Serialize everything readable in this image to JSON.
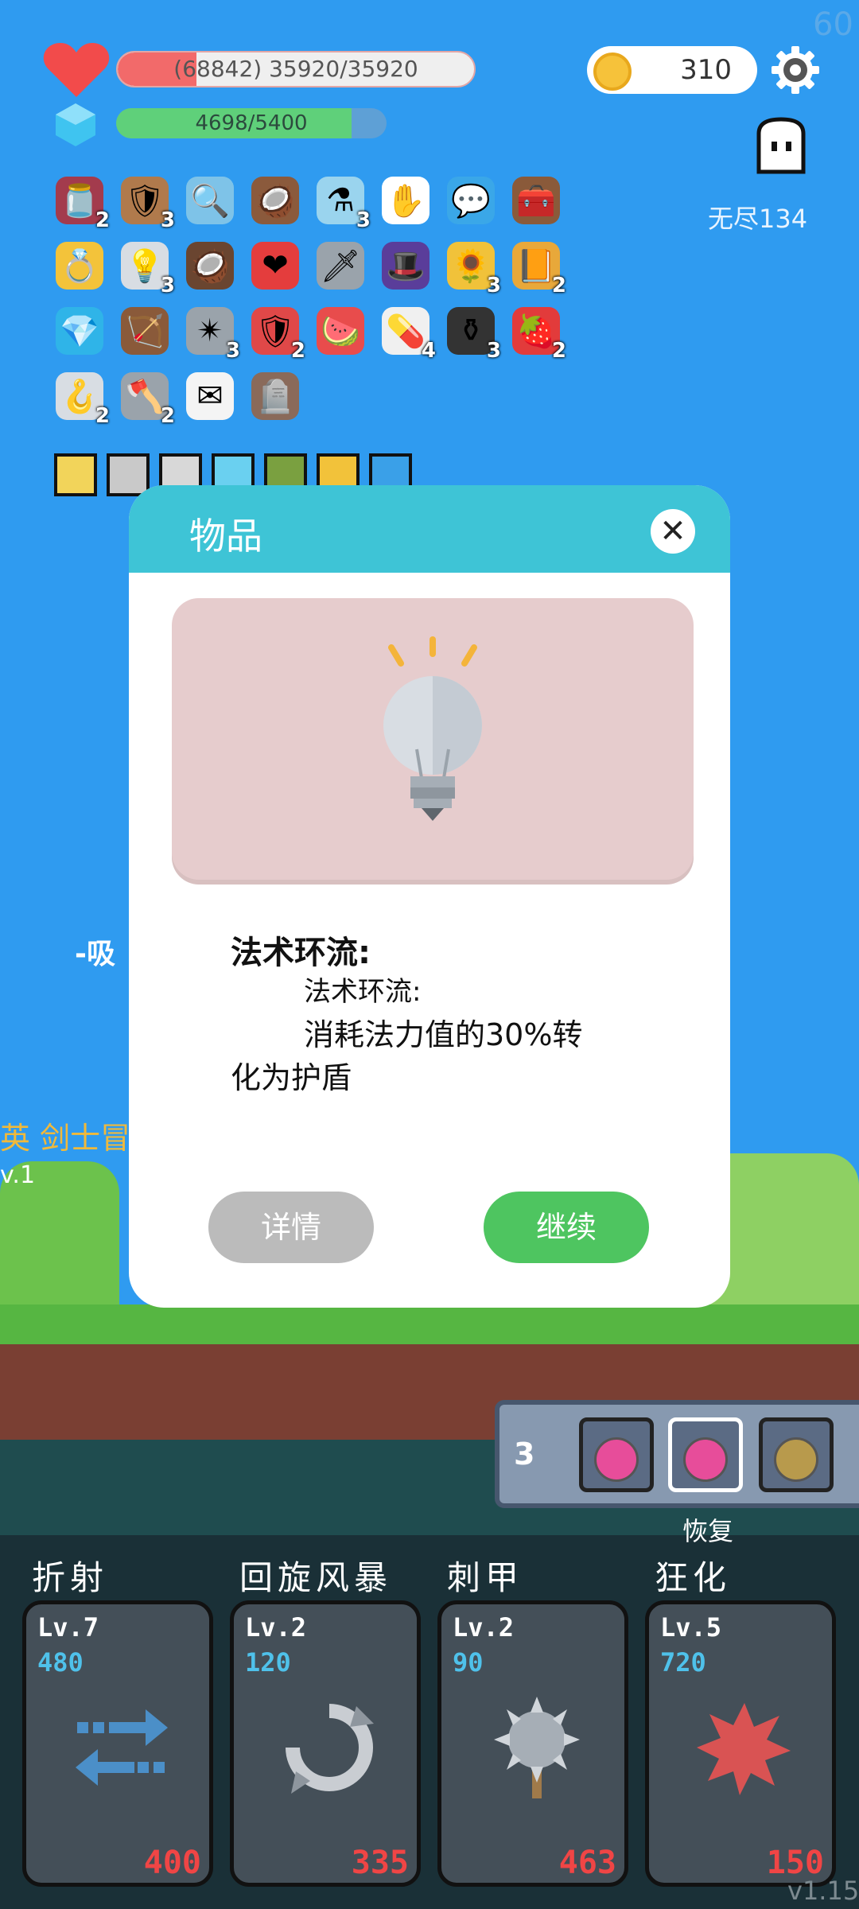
{
  "hud": {
    "fps": "60",
    "hp_text": "(68842) 35920/35920",
    "hp_fraction": 0.22,
    "mp_text": "4698/5400",
    "mp_fraction": 0.87,
    "coins": "310",
    "mode_label": "无尽134"
  },
  "inventory": {
    "items": [
      {
        "icon": "jam-jar-icon",
        "glyph": "🫙",
        "count": "2",
        "bg": "#a33b4d"
      },
      {
        "icon": "wooden-shield-icon",
        "glyph": "🛡",
        "count": "3",
        "bg": "#b07a4c"
      },
      {
        "icon": "magnifier-icon",
        "glyph": "🔍",
        "count": "",
        "bg": "#7ec3e8"
      },
      {
        "icon": "coconut-drink-icon",
        "glyph": "🥥",
        "count": "",
        "bg": "#8b5a3c"
      },
      {
        "icon": "potion-flask-icon",
        "glyph": "⚗",
        "count": "3",
        "bg": "#9ad4ee"
      },
      {
        "icon": "glove-icon",
        "glyph": "✋",
        "count": "",
        "bg": "#ffffff"
      },
      {
        "icon": "speech-bubble-icon",
        "glyph": "💬",
        "count": "",
        "bg": "#3aa7e8"
      },
      {
        "icon": "treasure-chest-icon",
        "glyph": "🧰",
        "count": "",
        "bg": "#8a5a3a"
      },
      {
        "icon": "ring-icon",
        "glyph": "💍",
        "count": "",
        "bg": "#f3c33a"
      },
      {
        "icon": "light-bulb-icon",
        "glyph": "💡",
        "count": "3",
        "bg": "#d8dde3"
      },
      {
        "icon": "coconut-icon",
        "glyph": "🥥",
        "count": "",
        "bg": "#6a4530"
      },
      {
        "icon": "hearts-icon",
        "glyph": "❤",
        "count": "",
        "bg": "#e43d3d"
      },
      {
        "icon": "sword-icon",
        "glyph": "🗡",
        "count": "",
        "bg": "#9aa3ab"
      },
      {
        "icon": "purple-hat-icon",
        "glyph": "🎩",
        "count": "",
        "bg": "#5a3d9a"
      },
      {
        "icon": "sunflower-icon",
        "glyph": "🌻",
        "count": "3",
        "bg": "#f1c23a"
      },
      {
        "icon": "book-icon",
        "glyph": "📙",
        "count": "2",
        "bg": "#e8a83a"
      },
      {
        "icon": "blue-gem-icon",
        "glyph": "💎",
        "count": "",
        "bg": "#2fb4e8"
      },
      {
        "icon": "bow-icon",
        "glyph": "🏹",
        "count": "",
        "bg": "#8a5a3a"
      },
      {
        "icon": "spiked-club-icon",
        "glyph": "✴",
        "count": "3",
        "bg": "#9aa3ab"
      },
      {
        "icon": "red-shield-icon",
        "glyph": "🛡",
        "count": "2",
        "bg": "#e04848"
      },
      {
        "icon": "watermelon-icon",
        "glyph": "🍉",
        "count": "",
        "bg": "#e84c4c"
      },
      {
        "icon": "pill-icon",
        "glyph": "💊",
        "count": "4",
        "bg": "#f0f0f0"
      },
      {
        "icon": "cauldron-icon",
        "glyph": "⚱",
        "count": "3",
        "bg": "#333333"
      },
      {
        "icon": "strawberry-icon",
        "glyph": "🍓",
        "count": "2",
        "bg": "#e23b3b"
      },
      {
        "icon": "hook-icon",
        "glyph": "🪝",
        "count": "2",
        "bg": "#d8dde3"
      },
      {
        "icon": "axe-icon",
        "glyph": "🪓",
        "count": "2",
        "bg": "#9aa3ab"
      },
      {
        "icon": "envelope-icon",
        "glyph": "✉",
        "count": "",
        "bg": "#f4f4f4"
      },
      {
        "icon": "gravestone-icon",
        "glyph": "🪦",
        "count": "",
        "bg": "#8a6a5a"
      }
    ],
    "pixel_items": [
      {
        "icon": "pixel-lightbulb-icon",
        "color": "#f2d45a"
      },
      {
        "icon": "pixel-sword-icon",
        "color": "#c9c9c9"
      },
      {
        "icon": "pixel-armor-icon",
        "color": "#d8d8d8"
      },
      {
        "icon": "pixel-crystal-icon",
        "color": "#6ad0f0"
      },
      {
        "icon": "pixel-creature-icon",
        "color": "#7aa040"
      },
      {
        "icon": "pixel-crown-icon",
        "color": "#f2c23a"
      },
      {
        "icon": "pixel-orb-icon",
        "color": "#3aa0e8"
      }
    ]
  },
  "scene": {
    "float_text": "-吸",
    "hero_label": "英 剑士冒",
    "hero_level": "v.1"
  },
  "potions": {
    "count": "3",
    "label": "恢复"
  },
  "skills": [
    {
      "name": "折射",
      "level": "Lv.7",
      "cost": "480",
      "damage": "400",
      "icon": "refraction-arrows-icon"
    },
    {
      "name": "回旋风暴",
      "level": "Lv.2",
      "cost": "120",
      "damage": "335",
      "icon": "whirlwind-icon"
    },
    {
      "name": "刺甲",
      "level": "Lv.2",
      "cost": "90",
      "damage": "463",
      "icon": "spiked-mace-icon"
    },
    {
      "name": "狂化",
      "level": "Lv.5",
      "cost": "720",
      "damage": "150",
      "icon": "berserk-splat-icon"
    }
  ],
  "modal": {
    "title": "物品",
    "item_name": "法术环流:",
    "desc_head": "法术环流:",
    "desc_body": "消耗法力值的30%转",
    "desc_tail": "化为护盾",
    "detail_button": "详情",
    "continue_button": "继续",
    "preview_icon": "light-bulb-icon"
  },
  "version": "v1.15"
}
